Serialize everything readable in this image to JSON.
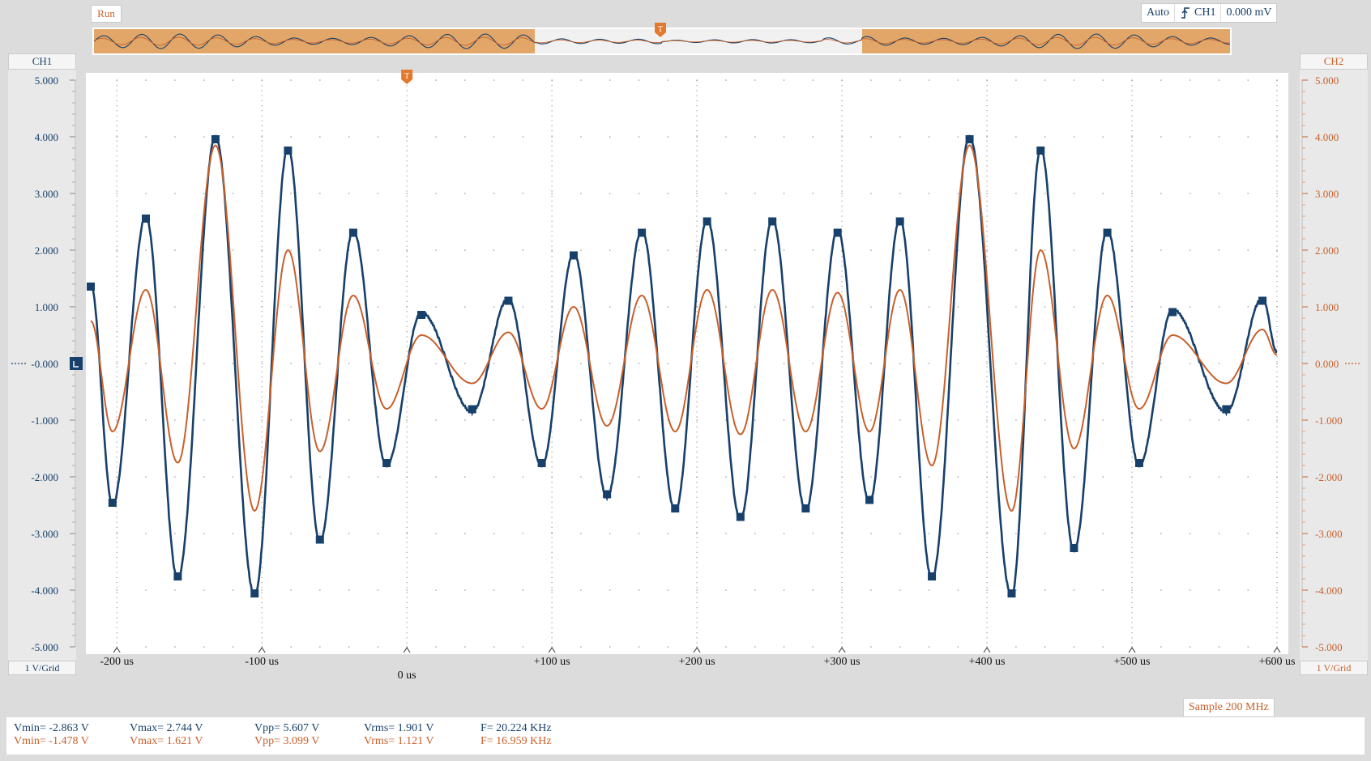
{
  "toolbar": {
    "run_label": "Run",
    "trigger_mode": "Auto",
    "trigger_source": "CH1",
    "trigger_level": "0.000 mV",
    "trigger_edge_icon": "rising-edge-icon"
  },
  "left_axis": {
    "channel": "CH1",
    "scale": "1 V/Grid",
    "ticks": [
      "5.000",
      "4.000",
      "3.000",
      "2.000",
      "1.000",
      "-0.000",
      "-1.000",
      "-2.000",
      "-3.000",
      "-4.000",
      "-5.000"
    ],
    "color": "#17406b"
  },
  "right_axis": {
    "channel": "CH2",
    "scale": "1 V/Grid",
    "ticks": [
      "5.000",
      "4.000",
      "3.000",
      "2.000",
      "1.000",
      "0.000",
      "-1.000",
      "-2.000",
      "-3.000",
      "-4.000",
      "-5.000"
    ],
    "color": "#c8602b"
  },
  "x_axis": {
    "ticks": [
      "-200 us",
      "-100 us",
      "0 us",
      "+100 us",
      "+200 us",
      "+300 us",
      "+400 us",
      "+500 us",
      "+600 us"
    ],
    "values": [
      -200,
      -100,
      0,
      100,
      200,
      300,
      400,
      500,
      600
    ]
  },
  "sample_rate": "Sample 200 MHz",
  "measurements": {
    "ch1": {
      "vmin": "Vmin= -2.863 V",
      "vmax": "Vmax= 2.744 V",
      "vpp": "Vpp= 5.607 V",
      "vrms": "Vrms= 1.901 V",
      "freq": "F= 20.224 KHz"
    },
    "ch2": {
      "vmin": "Vmin= -1.478 V",
      "vmax": "Vmax= 1.621 V",
      "vpp": "Vpp= 3.099 V",
      "vrms": "Vrms= 1.121 V",
      "freq": "F= 16.959 KHz"
    }
  },
  "trigger_marker_icon": "trigger-marker-icon",
  "ch1_offset_marker_icon": "ch1-offset-marker-icon",
  "colors": {
    "ch1": "#17406b",
    "ch2": "#c8602b",
    "overview_fill": "#e2a768"
  },
  "waveform": {
    "x_range_us": [
      -218,
      600
    ],
    "y_range_v": [
      -5,
      5
    ],
    "ch1_peaks": [
      {
        "t": -218,
        "v": 1.4
      },
      {
        "t": -203,
        "v": -2.5
      },
      {
        "t": -180,
        "v": 2.6
      },
      {
        "t": -158,
        "v": -3.8
      },
      {
        "t": -132,
        "v": 4.0
      },
      {
        "t": -105,
        "v": -4.1
      },
      {
        "t": -82,
        "v": 3.8
      },
      {
        "t": -60,
        "v": -3.15
      },
      {
        "t": -37,
        "v": 2.35
      },
      {
        "t": -14,
        "v": -1.8
      },
      {
        "t": 10,
        "v": 0.9
      },
      {
        "t": 45,
        "v": -0.85
      },
      {
        "t": 70,
        "v": 1.15
      },
      {
        "t": 93,
        "v": -1.8
      },
      {
        "t": 115,
        "v": 1.95
      },
      {
        "t": 138,
        "v": -2.35
      },
      {
        "t": 162,
        "v": 2.35
      },
      {
        "t": 185,
        "v": -2.6
      },
      {
        "t": 207,
        "v": 2.55
      },
      {
        "t": 230,
        "v": -2.75
      },
      {
        "t": 252,
        "v": 2.55
      },
      {
        "t": 275,
        "v": -2.6
      },
      {
        "t": 297,
        "v": 2.35
      },
      {
        "t": 319,
        "v": -2.45
      },
      {
        "t": 340,
        "v": 2.55
      },
      {
        "t": 362,
        "v": -3.8
      },
      {
        "t": 388,
        "v": 4.0
      },
      {
        "t": 417,
        "v": -4.1
      },
      {
        "t": 437,
        "v": 3.8
      },
      {
        "t": 460,
        "v": -3.3
      },
      {
        "t": 483,
        "v": 2.35
      },
      {
        "t": 505,
        "v": -1.8
      },
      {
        "t": 528,
        "v": 0.95
      },
      {
        "t": 565,
        "v": -0.85
      },
      {
        "t": 590,
        "v": 1.15
      },
      {
        "t": 600,
        "v": 0.2
      }
    ],
    "ch2_peaks": [
      {
        "t": -218,
        "v": 0.75
      },
      {
        "t": -203,
        "v": -1.2
      },
      {
        "t": -180,
        "v": 1.3
      },
      {
        "t": -158,
        "v": -1.75
      },
      {
        "t": -132,
        "v": 3.85
      },
      {
        "t": -105,
        "v": -2.6
      },
      {
        "t": -82,
        "v": 2.0
      },
      {
        "t": -60,
        "v": -1.55
      },
      {
        "t": -37,
        "v": 1.2
      },
      {
        "t": -14,
        "v": -0.8
      },
      {
        "t": 10,
        "v": 0.5
      },
      {
        "t": 45,
        "v": -0.35
      },
      {
        "t": 70,
        "v": 0.55
      },
      {
        "t": 93,
        "v": -0.8
      },
      {
        "t": 115,
        "v": 1.0
      },
      {
        "t": 138,
        "v": -1.1
      },
      {
        "t": 162,
        "v": 1.2
      },
      {
        "t": 185,
        "v": -1.2
      },
      {
        "t": 207,
        "v": 1.3
      },
      {
        "t": 230,
        "v": -1.25
      },
      {
        "t": 252,
        "v": 1.3
      },
      {
        "t": 275,
        "v": -1.2
      },
      {
        "t": 297,
        "v": 1.25
      },
      {
        "t": 319,
        "v": -1.2
      },
      {
        "t": 340,
        "v": 1.3
      },
      {
        "t": 362,
        "v": -1.8
      },
      {
        "t": 388,
        "v": 3.85
      },
      {
        "t": 417,
        "v": -2.6
      },
      {
        "t": 437,
        "v": 2.0
      },
      {
        "t": 460,
        "v": -1.5
      },
      {
        "t": 483,
        "v": 1.2
      },
      {
        "t": 505,
        "v": -0.8
      },
      {
        "t": 528,
        "v": 0.5
      },
      {
        "t": 565,
        "v": -0.35
      },
      {
        "t": 590,
        "v": 0.6
      },
      {
        "t": 600,
        "v": 0.15
      }
    ]
  }
}
